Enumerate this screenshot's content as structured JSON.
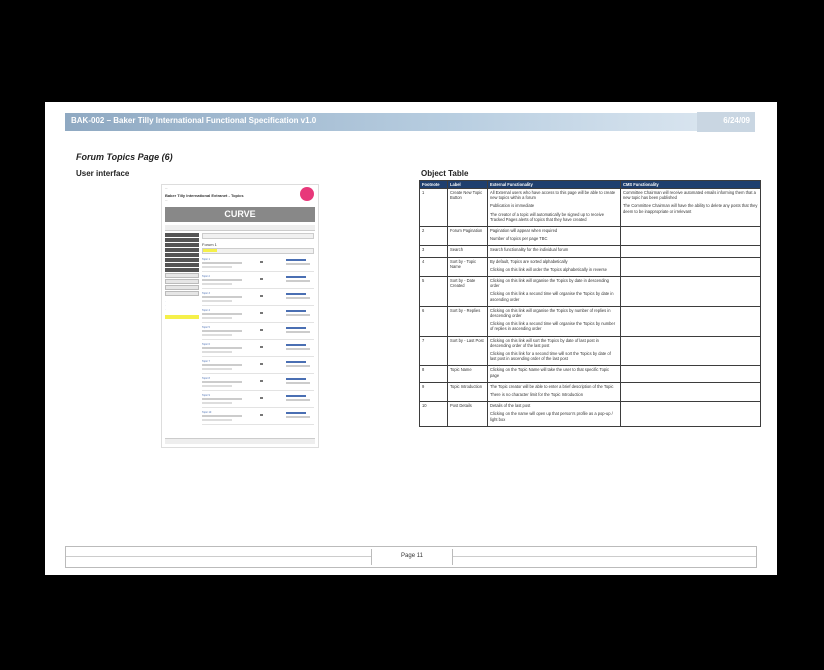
{
  "header": {
    "title": "BAK-002 – Baker Tilly International Functional Specification v1.0",
    "date": "6/24/09"
  },
  "section_title": "Forum Topics Page (6)",
  "ui_heading": "User interface",
  "object_heading": "Object Table",
  "mockup": {
    "site_title": "Baker Tilly International Extranet - Topics",
    "banner": "CURVE",
    "forum_title": "Forum 1",
    "topics": [
      "Topic 1",
      "Topic 2",
      "Topic 3",
      "Topic 4",
      "Topic 5",
      "Topic 6",
      "Topic 7",
      "Topic 8",
      "Topic 9",
      "Topic 10"
    ]
  },
  "table": {
    "columns": [
      "Footnote",
      "Label",
      "External Functionality",
      "CMS Functionality"
    ],
    "rows": [
      {
        "num": "1",
        "label": "Create New Topic Button",
        "ext": [
          "All External users who have access to this page will be able to create new topics within a forum",
          "Publication is immediate",
          "The creator of a topic will automatically be signed up to receive Tracked Pages alerts of topics that they have created"
        ],
        "cms": [
          "Committee Chairman will receive automated emails informing them that a new topic has been published",
          "The Committee Chairman will have the ability to delete any posts that they deem to be inappropriate or irrelevant"
        ]
      },
      {
        "num": "2",
        "label": "Forum Pagination",
        "ext": [
          "Pagination will appear when required",
          "Number of topics per page TBC"
        ],
        "cms": []
      },
      {
        "num": "3",
        "label": "Search",
        "ext": [
          "Search functionality for the individual forum"
        ],
        "cms": []
      },
      {
        "num": "4",
        "label": "Sort by - Topic Name",
        "ext": [
          "By default, Topics are sorted alphabetically",
          "Clicking on this link will order the Topics alphabetically in reverse"
        ],
        "cms": []
      },
      {
        "num": "5",
        "label": "Sort by - Date Created",
        "ext": [
          "Clicking on this link will organise the Topics by date in descending order",
          "Clicking on this link a second time will organise the Topics by date in ascending order"
        ],
        "cms": []
      },
      {
        "num": "6",
        "label": "Sort by - Replies",
        "ext": [
          "Clicking on this link will organise the Topics by number of replies in descending order",
          "Clicking on this link a second time will organise the Topics by number of replies in ascending order"
        ],
        "cms": []
      },
      {
        "num": "7",
        "label": "Sort by - Last Post",
        "ext": [
          "Clicking on this link will sort the Topics by date of last post in descending order of the last post",
          "Clicking on this link for a second time will sort the Topics by date of last post in ascending order of the last post"
        ],
        "cms": []
      },
      {
        "num": "8",
        "label": "Topic Name",
        "ext": [
          "Clicking on the Topic Name will take the user to that specific Topic page"
        ],
        "cms": []
      },
      {
        "num": "9",
        "label": "Topic Introduction",
        "ext": [
          "The Topic creator will be able to enter a brief description of the Topic",
          "There is no character limit for the Topic Introduction"
        ],
        "cms": []
      },
      {
        "num": "10",
        "label": "Post Details",
        "ext": [
          "Details of the last post",
          "Clicking on the name will open up that person's profile as a pop-up / light box"
        ],
        "cms": []
      }
    ]
  },
  "footer": {
    "page": "Page 11"
  }
}
